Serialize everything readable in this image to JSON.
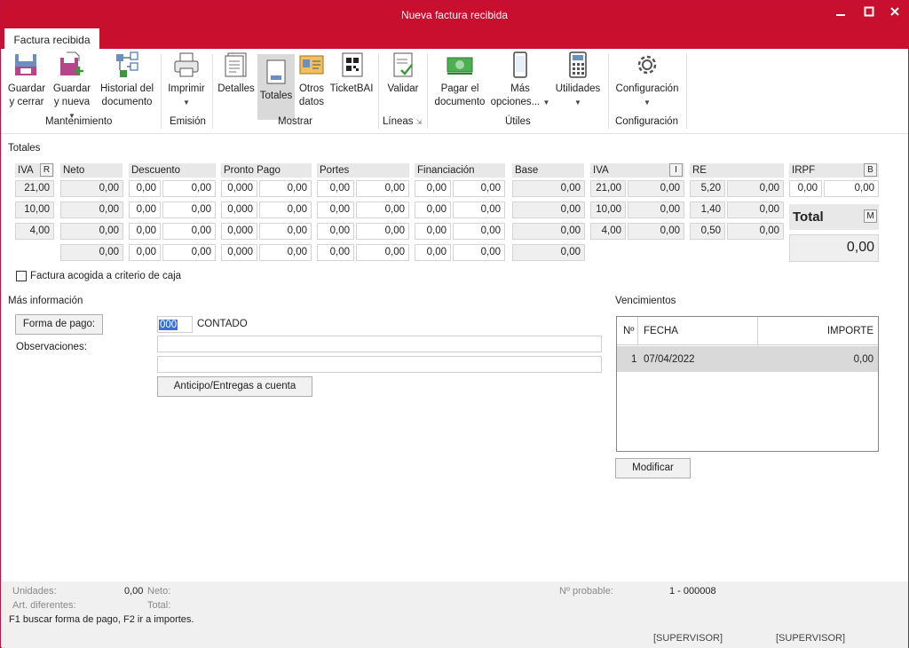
{
  "window": {
    "title": "Nueva factura recibida"
  },
  "tabs": [
    {
      "label": "Factura recibida"
    }
  ],
  "ribbon": {
    "buttons": [
      {
        "line1": "Guardar",
        "line2": "y cerrar",
        "icon": "save-close-icon"
      },
      {
        "line1": "Guardar",
        "line2": "y nueva",
        "icon": "save-new-icon"
      },
      {
        "line1": "Historial del",
        "line2": "documento",
        "icon": "history-icon"
      },
      {
        "line1": "Imprimir",
        "line2": "",
        "icon": "printer-icon"
      },
      {
        "line1": "Detalles",
        "line2": "",
        "icon": "details-icon"
      },
      {
        "line1": "Totales",
        "line2": "",
        "icon": "totals-icon"
      },
      {
        "line1": "Otros",
        "line2": "datos",
        "icon": "other-data-icon"
      },
      {
        "line1": "TicketBAI",
        "line2": "",
        "icon": "qr-code-icon"
      },
      {
        "line1": "Validar",
        "line2": "",
        "icon": "validate-icon"
      },
      {
        "line1": "Pagar el",
        "line2": "documento",
        "icon": "pay-money-icon"
      },
      {
        "line1": "Más",
        "line2": "opciones...",
        "icon": "phone-icon"
      },
      {
        "line1": "Utilidades",
        "line2": "",
        "icon": "calculator-icon"
      },
      {
        "line1": "Configuración",
        "line2": "",
        "icon": "gear-icon"
      }
    ],
    "groups": [
      "Mantenimiento",
      "Emisión",
      "Mostrar",
      "Líneas",
      "Útiles",
      "Configuración"
    ]
  },
  "totales": {
    "section_title": "Totales",
    "headers": {
      "iva": "IVA",
      "neto": "Neto",
      "descuento": "Descuento",
      "pronto_pago": "Pronto Pago",
      "portes": "Portes",
      "financiacion": "Financiación",
      "base": "Base",
      "iva2": "IVA",
      "re": "RE",
      "irpf": "IRPF"
    },
    "toggles": {
      "r": "R",
      "i": "I",
      "b": "B",
      "m": "M"
    },
    "rows": [
      {
        "iva": "21,00",
        "neto": "0,00",
        "desc_pct": "0,00",
        "desc_val": "0,00",
        "pp_pct": "0,000",
        "pp_val": "0,00",
        "portes_pct": "0,00",
        "portes_val": "0,00",
        "fin_pct": "0,00",
        "fin_val": "0,00",
        "base": "0,00",
        "iva_pct": "21,00",
        "iva_val": "0,00",
        "re_pct": "5,20",
        "re_val": "0,00"
      },
      {
        "iva": "10,00",
        "neto": "0,00",
        "desc_pct": "0,00",
        "desc_val": "0,00",
        "pp_pct": "0,000",
        "pp_val": "0,00",
        "portes_pct": "0,00",
        "portes_val": "0,00",
        "fin_pct": "0,00",
        "fin_val": "0,00",
        "base": "0,00",
        "iva_pct": "10,00",
        "iva_val": "0,00",
        "re_pct": "1,40",
        "re_val": "0,00"
      },
      {
        "iva": "4,00",
        "neto": "0,00",
        "desc_pct": "0,00",
        "desc_val": "0,00",
        "pp_pct": "0,000",
        "pp_val": "0,00",
        "portes_pct": "0,00",
        "portes_val": "0,00",
        "fin_pct": "0,00",
        "fin_val": "0,00",
        "base": "0,00",
        "iva_pct": "4,00",
        "iva_val": "0,00",
        "re_pct": "0,50",
        "re_val": "0,00"
      }
    ],
    "totals_row": {
      "neto": "0,00",
      "desc_pct": "0,00",
      "desc_val": "0,00",
      "pp_pct": "0,000",
      "pp_val": "0,00",
      "portes_pct": "0,00",
      "portes_val": "0,00",
      "fin_pct": "0,00",
      "fin_val": "0,00",
      "base": "0,00"
    },
    "irpf": {
      "pct": "0,00",
      "val": "0,00"
    },
    "total_label": "Total",
    "total_value": "0,00",
    "criterio_caja": "Factura acogida a criterio de caja"
  },
  "mas_info": {
    "title": "Más información",
    "forma_pago_button": "Forma de pago:",
    "forma_pago_code": "000",
    "forma_pago_name": "CONTADO",
    "observaciones_label": "Observaciones:",
    "anticipo_button": "Anticipo/Entregas a cuenta"
  },
  "vencimientos": {
    "title": "Vencimientos",
    "columns": {
      "n": "Nº",
      "fecha": "FECHA",
      "importe": "IMPORTE"
    },
    "rows": [
      {
        "n": "1",
        "fecha": "07/04/2022",
        "importe": "0,00"
      }
    ],
    "modificar_button": "Modificar"
  },
  "status": {
    "unidades_label": "Unidades:",
    "unidades_value": "0,00",
    "neto_label": "Neto:",
    "art_label": "Art. diferentes:",
    "total_label": "Total:",
    "probable_label": "Nº probable:",
    "probable_value": "1 - 000008",
    "help": "F1 buscar forma de pago, F2 ir a importes.",
    "user1": "[SUPERVISOR]",
    "user2": "[SUPERVISOR]"
  },
  "colors": {
    "accent": "#c8102e"
  }
}
